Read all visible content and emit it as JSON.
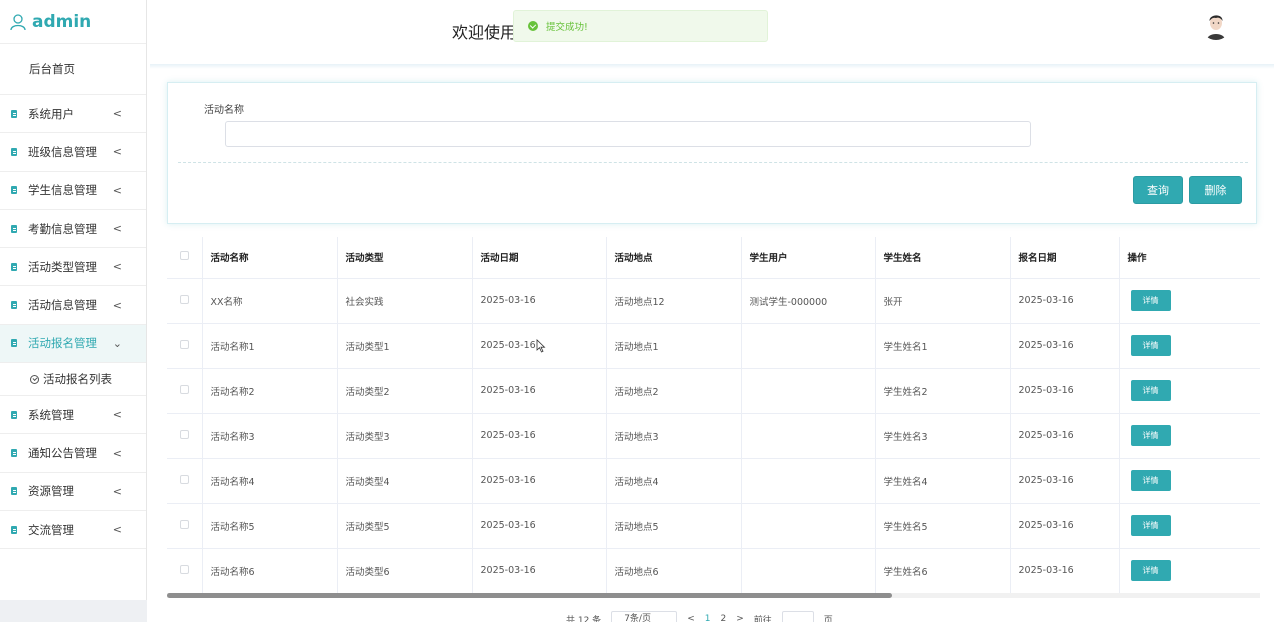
{
  "sidebar": {
    "brand": "admin",
    "home": "后台首页",
    "items": [
      {
        "label": "系统用户",
        "chevron": "<"
      },
      {
        "label": "班级信息管理",
        "chevron": "<"
      },
      {
        "label": "学生信息管理",
        "chevron": "<"
      },
      {
        "label": "考勤信息管理",
        "chevron": "<"
      },
      {
        "label": "活动类型管理",
        "chevron": "<"
      },
      {
        "label": "活动信息管理",
        "chevron": "<"
      },
      {
        "label": "活动报名管理",
        "chevron": "⌄"
      },
      {
        "label": "系统管理",
        "chevron": "<"
      },
      {
        "label": "通知公告管理",
        "chevron": "<"
      },
      {
        "label": "资源管理",
        "chevron": "<"
      },
      {
        "label": "交流管理",
        "chevron": "<"
      }
    ],
    "sub_item": "活动报名列表"
  },
  "header": {
    "welcome": "欢迎使用",
    "toast": "提交成功!"
  },
  "search": {
    "field_label": "活动名称",
    "field_value": "",
    "query_label": "查询",
    "delete_label": "删除"
  },
  "table": {
    "columns": [
      "活动名称",
      "活动类型",
      "活动日期",
      "活动地点",
      "学生用户",
      "学生姓名",
      "报名日期",
      "操作"
    ],
    "rows": [
      [
        "XX名称",
        "社会实践",
        "2025-03-16",
        "活动地点12",
        "测试学生-000000",
        "张开",
        "2025-03-16"
      ],
      [
        "活动名称1",
        "活动类型1",
        "2025-03-16",
        "活动地点1",
        "",
        "学生姓名1",
        "2025-03-16"
      ],
      [
        "活动名称2",
        "活动类型2",
        "2025-03-16",
        "活动地点2",
        "",
        "学生姓名2",
        "2025-03-16"
      ],
      [
        "活动名称3",
        "活动类型3",
        "2025-03-16",
        "活动地点3",
        "",
        "学生姓名3",
        "2025-03-16"
      ],
      [
        "活动名称4",
        "活动类型4",
        "2025-03-16",
        "活动地点4",
        "",
        "学生姓名4",
        "2025-03-16"
      ],
      [
        "活动名称5",
        "活动类型5",
        "2025-03-16",
        "活动地点5",
        "",
        "学生姓名5",
        "2025-03-16"
      ],
      [
        "活动名称6",
        "活动类型6",
        "2025-03-16",
        "活动地点6",
        "",
        "学生姓名6",
        "2025-03-16"
      ]
    ],
    "detail_label": "详情"
  },
  "pager": {
    "total": "共 12 条",
    "page_size": "7条/页",
    "prev": "<",
    "pages": [
      "1",
      "2"
    ],
    "next": ">",
    "goto": "前往",
    "page_unit": "页"
  },
  "colors": {
    "accent": "#30a9b1",
    "success": "#67c23a"
  }
}
